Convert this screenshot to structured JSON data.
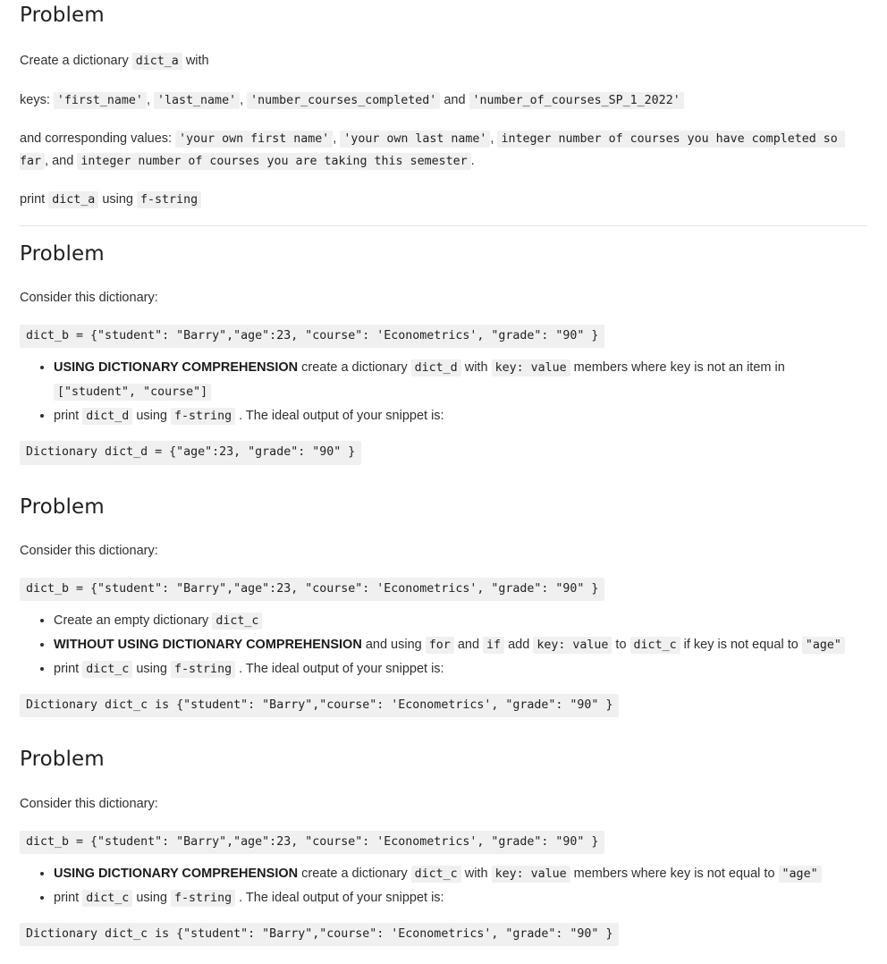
{
  "document": {
    "heading_label": "Problem",
    "divider_present": true
  },
  "sections": [
    {
      "title": "Problem",
      "lead": "Create a dictionary",
      "lead_code": "dict_a",
      "lead_tail": "with",
      "keys_label": "keys:",
      "keys": [
        "'first_name'",
        "'last_name'",
        "'number_courses_completed'",
        "'number_of_courses_SP_1_2022'"
      ],
      "keys_conjunction": "and",
      "values_label": "and corresponding values:",
      "values": [
        "'your own first name'",
        "'your own last name'",
        "integer number of courses you have completed so far",
        "integer number of courses you are taking this semester"
      ],
      "values_conjunction": ", and",
      "values_terminator": ".",
      "print_prefix": "print",
      "print_code": "dict_a",
      "print_middle": "using",
      "print_code2": "f-string"
    },
    {
      "title": "Problem",
      "consider": "Consider this dictionary:",
      "dict_block": "dict_b = {\"student\": \"Barry\",\"age\":23, \"course\": 'Econometrics', \"grade\": \"90\" }",
      "bullets": [
        {
          "strong": "USING DICTIONARY COMPREHENSION",
          "t1": "create a dictionary",
          "c1": "dict_d",
          "t2": "with",
          "c2": "key: value",
          "t3": "members where key is not an item in",
          "c3": "[\"student\", \"course\"]"
        },
        {
          "t1": "print",
          "c1": "dict_d",
          "t2": "using",
          "c2": "f-string",
          "t3": ". The ideal output of your snippet is:"
        }
      ],
      "output_block": "Dictionary dict_d = {\"age\":23, \"grade\": \"90\" }"
    },
    {
      "title": "Problem",
      "consider": "Consider this dictionary:",
      "dict_block": "dict_b = {\"student\": \"Barry\",\"age\":23, \"course\": 'Econometrics', \"grade\": \"90\" }",
      "bullets": [
        {
          "t1": "Create an empty dictionary",
          "c1": "dict_c"
        },
        {
          "strong": "WITHOUT USING DICTIONARY COMPREHENSION",
          "t1": "and using",
          "c1": "for",
          "t2": "and",
          "c2": "if",
          "t3": "add",
          "c3": "key: value",
          "t4": "to",
          "c4": "dict_c",
          "t5": "if key is not equal to",
          "c5": "\"age\""
        },
        {
          "t1": "print",
          "c1": "dict_c",
          "t2": "using",
          "c2": "f-string",
          "t3": ". The ideal output of your snippet is:"
        }
      ],
      "output_block": "Dictionary dict_c is {\"student\": \"Barry\",\"course\": 'Econometrics', \"grade\": \"90\" }"
    },
    {
      "title": "Problem",
      "consider": "Consider this dictionary:",
      "dict_block": "dict_b = {\"student\": \"Barry\",\"age\":23, \"course\": 'Econometrics', \"grade\": \"90\" }",
      "bullets": [
        {
          "strong": "USING DICTIONARY COMPREHENSION",
          "t1": "create a dictionary",
          "c1": "dict_c",
          "t2": "with",
          "c2": "key: value",
          "t3": "members where key is not equal to",
          "c3": "\"age\""
        },
        {
          "t1": "print",
          "c1": "dict_c",
          "t2": "using",
          "c2": "f-string",
          "t3": ". The ideal output of your snippet is:"
        }
      ],
      "output_block": "Dictionary dict_c is {\"student\": \"Barry\",\"course\": 'Econometrics', \"grade\": \"90\" }"
    }
  ],
  "colors": {
    "code_background": "#f0f0f0",
    "text": "#2f2f2f",
    "divider": "#e3e3e3",
    "page_background": "#ffffff"
  }
}
